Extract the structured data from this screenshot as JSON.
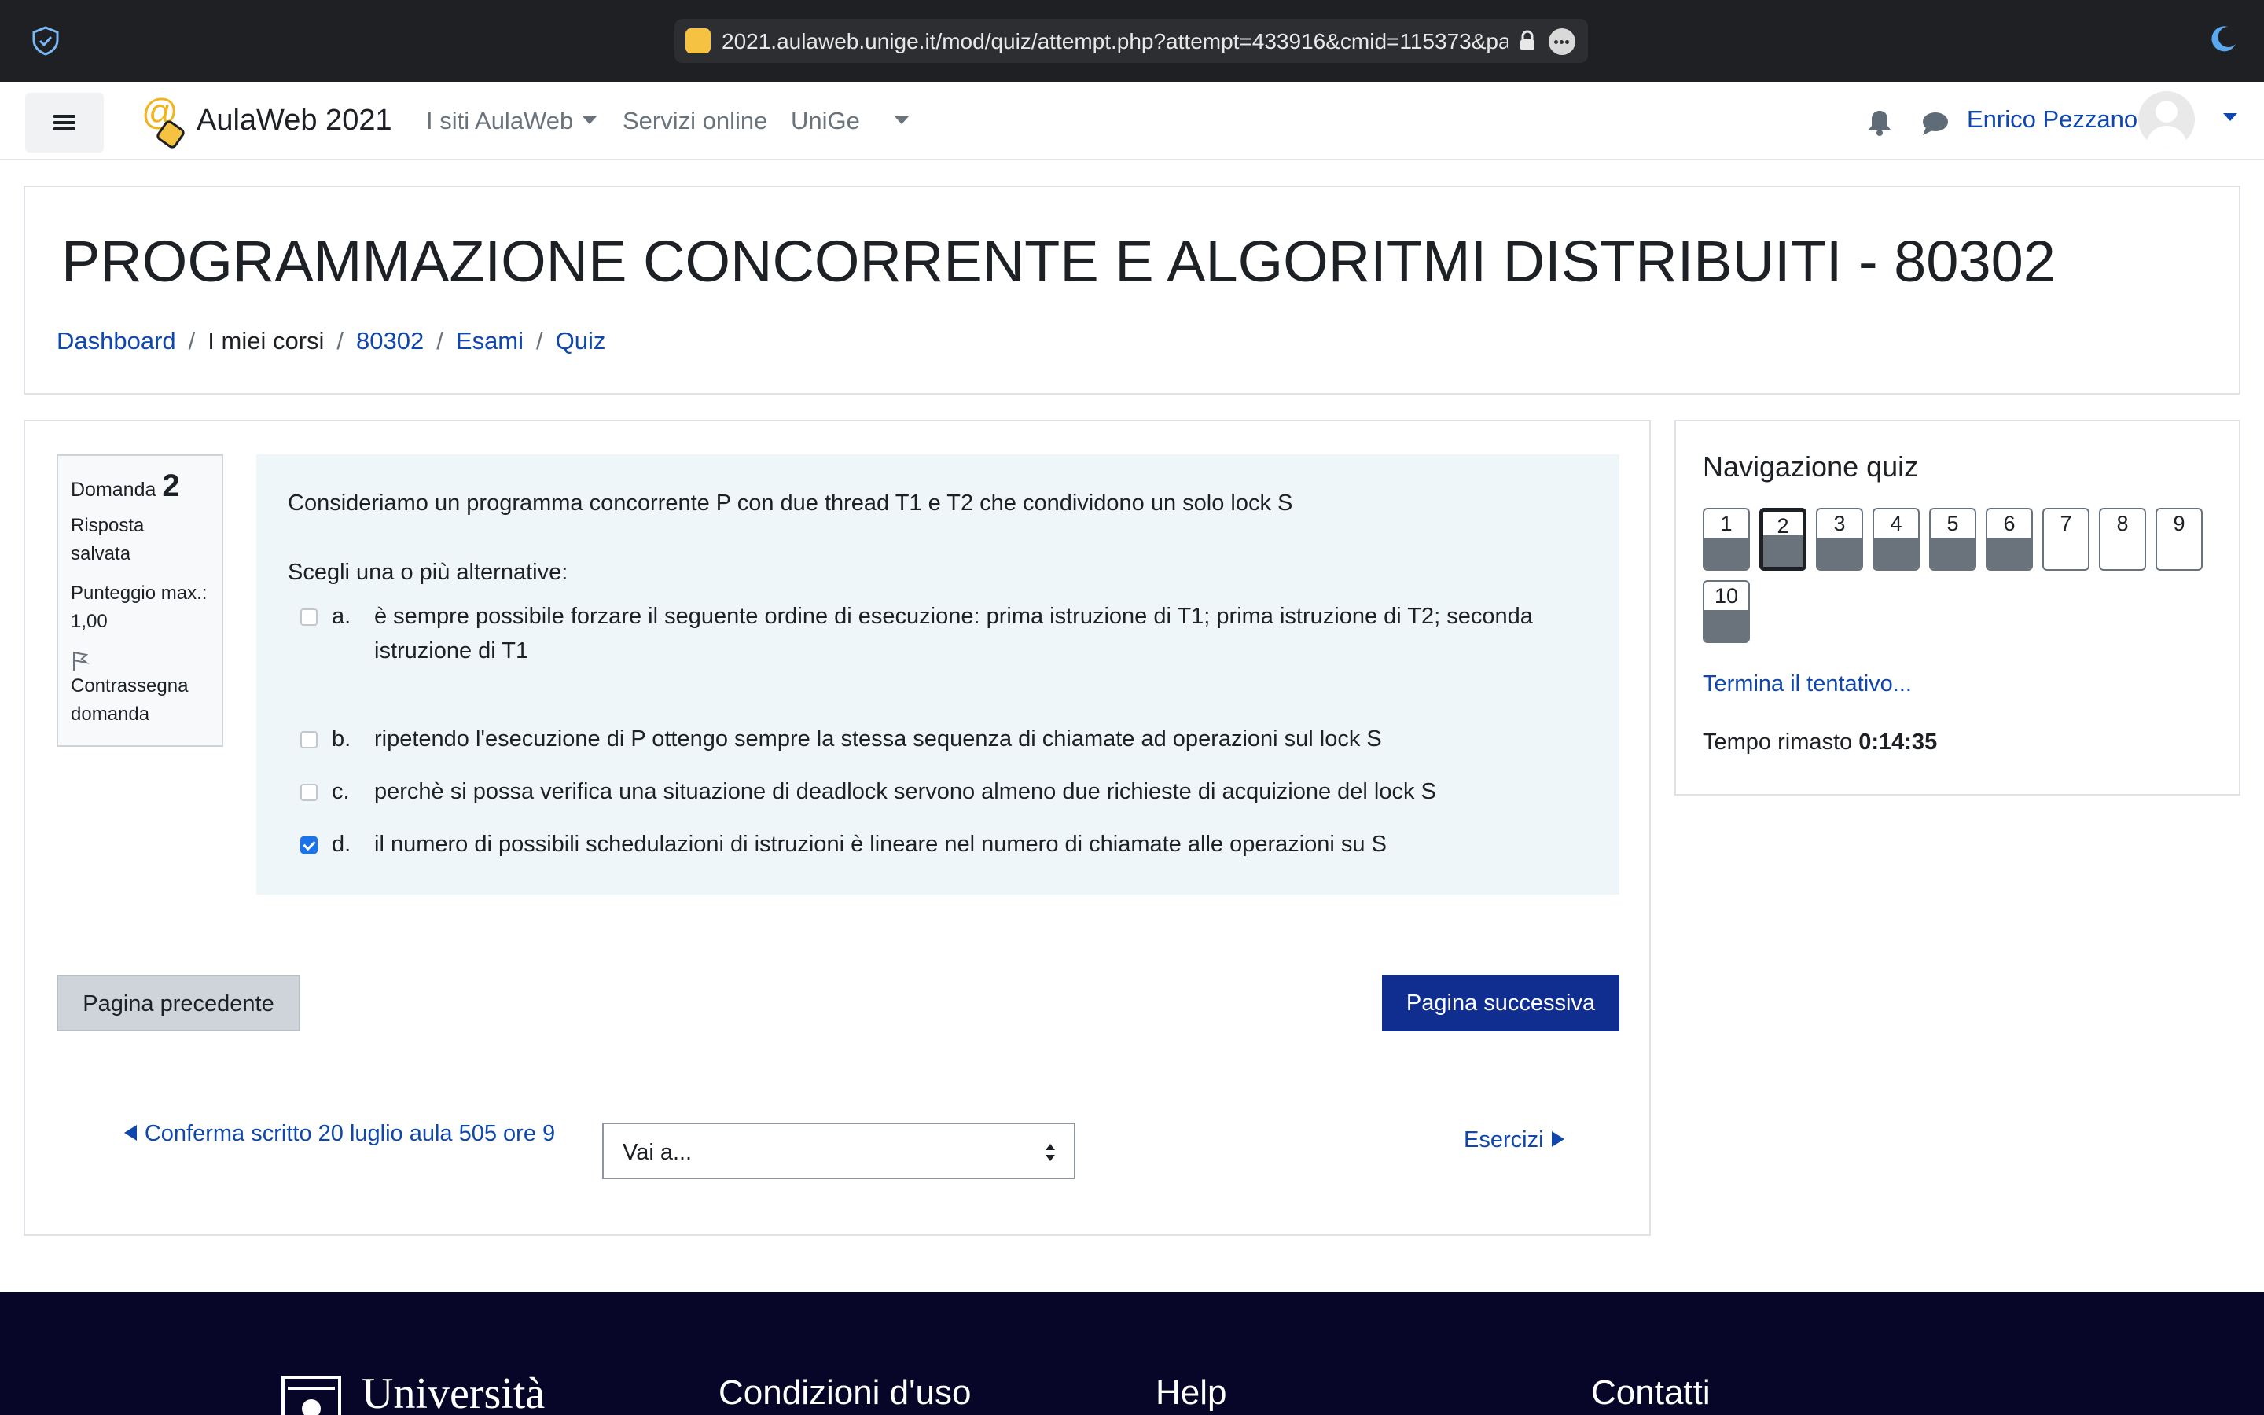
{
  "browser": {
    "url": "2021.aulaweb.unige.it/mod/quiz/attempt.php?attempt=433916&cmid=115373&pag"
  },
  "navbar": {
    "brand": "AulaWeb 2021",
    "menu_items": [
      "I siti AulaWeb",
      "Servizi online",
      "UniGe"
    ],
    "user_name": "Enrico Pezzano"
  },
  "course": {
    "title": "PROGRAMMAZIONE CONCORRENTE E ALGORITMI DISTRIBUITI - 80302",
    "breadcrumb": [
      "Dashboard",
      "I miei corsi",
      "80302",
      "Esami",
      "Quiz"
    ]
  },
  "question": {
    "label": "Domanda",
    "number": "2",
    "state": "Risposta salvata",
    "max_grade": "Punteggio max.: 1,00",
    "flag_label": "Contrassegna domanda",
    "text": "Consideriamo un programma concorrente P con due thread T1 e T2 che condividono un solo lock S",
    "prompt": "Scegli una o più alternative:",
    "answers": [
      {
        "letter": "a.",
        "text": "è sempre possibile forzare il seguente ordine di esecuzione: prima istruzione di T1; prima istruzione di T2; seconda istruzione di T1",
        "checked": false
      },
      {
        "letter": "b.",
        "text": "ripetendo l'esecuzione di P ottengo sempre la stessa sequenza di chiamate ad operazioni sul lock S",
        "checked": false
      },
      {
        "letter": "c.",
        "text": "perchè si possa verifica una situazione di deadlock servono almeno due richieste di acquizione del lock S",
        "checked": false
      },
      {
        "letter": "d.",
        "text": "il numero di possibili schedulazioni  di istruzioni è lineare nel numero di chiamate alle operazioni su S",
        "checked": true
      }
    ]
  },
  "buttons": {
    "previous_page": "Pagina precedente",
    "next_page": "Pagina successiva"
  },
  "activity_nav": {
    "previous": "Conferma scritto 20 luglio aula 505 ore 9",
    "jump_placeholder": "Vai a...",
    "next": "Esercizi"
  },
  "quiz_nav": {
    "title": "Navigazione quiz",
    "questions": [
      {
        "number": "1",
        "answered": true,
        "current": false
      },
      {
        "number": "2",
        "answered": true,
        "current": true
      },
      {
        "number": "3",
        "answered": true,
        "current": false
      },
      {
        "number": "4",
        "answered": true,
        "current": false
      },
      {
        "number": "5",
        "answered": true,
        "current": false
      },
      {
        "number": "6",
        "answered": true,
        "current": false
      },
      {
        "number": "7",
        "answered": false,
        "current": false
      },
      {
        "number": "8",
        "answered": false,
        "current": false
      },
      {
        "number": "9",
        "answered": false,
        "current": false
      },
      {
        "number": "10",
        "answered": true,
        "current": false
      }
    ],
    "finish_link": "Termina il tentativo...",
    "time_label": "Tempo rimasto",
    "time_value": "0:14:35"
  },
  "footer": {
    "university": "Università",
    "columns": [
      "Condizioni d'uso",
      "Help",
      "Contatti"
    ]
  },
  "colors": {
    "link": "#0f47ad",
    "primary_button": "#0f2e8f",
    "footer_bg": "#070629",
    "question_bg": "#eef6f9"
  }
}
